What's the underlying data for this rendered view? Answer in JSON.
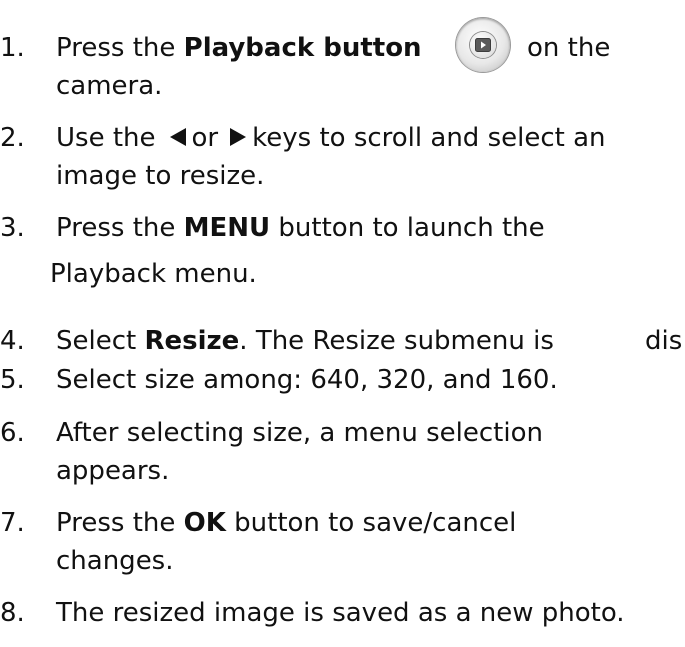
{
  "steps": [
    {
      "num": "1.",
      "a": "Press the ",
      "b": "Playback button",
      "c": "on the",
      "cont": "camera."
    },
    {
      "num": "2.",
      "a": "Use the",
      "or": "or",
      "c": "keys to scroll and select an",
      "cont": "image to resize."
    },
    {
      "num": "3.",
      "a": "Press the ",
      "b": "MENU",
      "c": " button to launch the",
      "cont": "Playback menu."
    },
    {
      "num": "4.",
      "a": "Select ",
      "b": "Resize",
      "c": ". The Resize submenu is",
      "tail": "dis"
    },
    {
      "num": "5.",
      "a": "Select size among: 640, 320, and 160."
    },
    {
      "num": "6.",
      "a": "After selecting size, a menu selection",
      "cont": "appears."
    },
    {
      "num": "7.",
      "a": "Press the ",
      "b": "OK",
      "c": " button to save/cancel",
      "cont": "changes."
    },
    {
      "num": "8.",
      "a": "The resized image is saved as a new photo."
    }
  ],
  "icons": {
    "playback": "playback-button-icon",
    "left": "left-arrow-icon",
    "right": "right-arrow-icon"
  }
}
